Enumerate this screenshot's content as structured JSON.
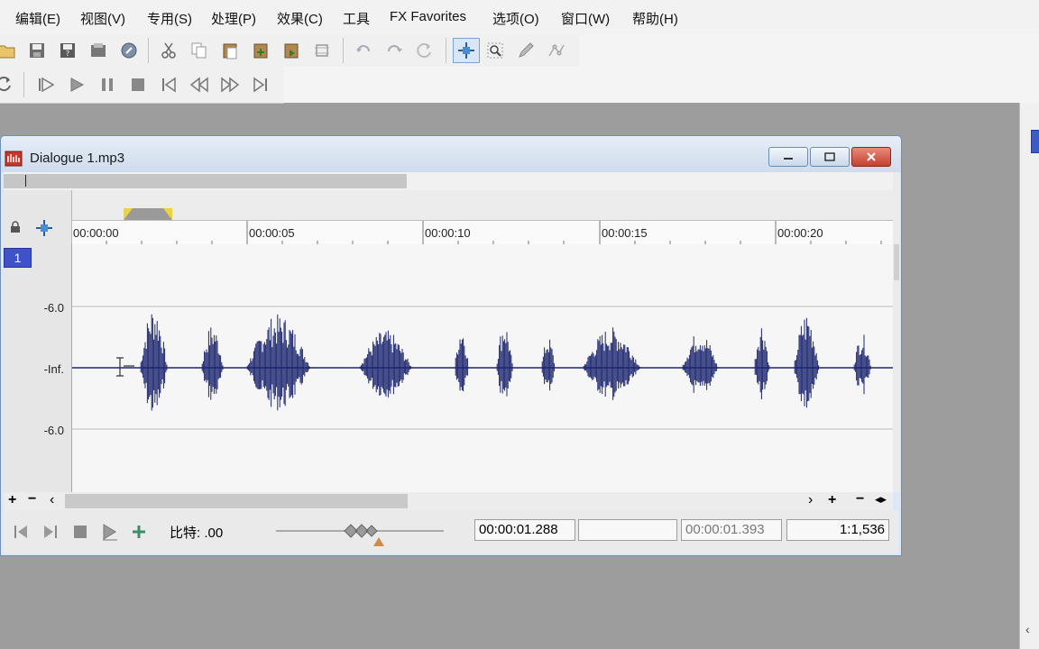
{
  "menu": [
    "编辑(E)",
    "视图(V)",
    "专用(S)",
    "处理(P)",
    "效果(C)",
    "工具",
    "FX Favorites",
    "选项(O)",
    "窗口(W)",
    "帮助(H)"
  ],
  "toolbar1": [
    {
      "name": "open-icon"
    },
    {
      "name": "save-icon"
    },
    {
      "name": "save-as-icon"
    },
    {
      "name": "render-icon"
    },
    {
      "name": "properties-icon"
    },
    {
      "name": "cut-icon"
    },
    {
      "name": "copy-icon"
    },
    {
      "name": "paste-icon"
    },
    {
      "name": "paste-new-icon"
    },
    {
      "name": "mix-icon"
    },
    {
      "name": "crop-icon"
    },
    {
      "name": "undo-icon"
    },
    {
      "name": "redo-icon"
    },
    {
      "name": "repeat-icon"
    },
    {
      "name": "edit-tool-icon"
    },
    {
      "name": "magnify-tool-icon"
    },
    {
      "name": "pencil-tool-icon"
    },
    {
      "name": "envelope-tool-icon"
    }
  ],
  "toolbar2": [
    {
      "name": "loop-icon"
    },
    {
      "name": "play-all-icon"
    },
    {
      "name": "play-icon"
    },
    {
      "name": "pause-icon"
    },
    {
      "name": "stop-icon"
    },
    {
      "name": "go-to-start-icon"
    },
    {
      "name": "rewind-icon"
    },
    {
      "name": "forward-icon"
    },
    {
      "name": "go-to-end-icon"
    }
  ],
  "window": {
    "title": "Dialogue 1.mp3",
    "track_number": "1",
    "ruler_labels": [
      "00:00:00",
      "00:00:05",
      "00:00:10",
      "00:00:15",
      "00:00:20"
    ],
    "db_labels": [
      "-6.0",
      "-Inf.",
      "-6.0"
    ],
    "wave_color": "#1c2670"
  },
  "transport": {
    "rate_label": "比特: .00",
    "cursor_time": "00:00:01.288",
    "selection_blank": "",
    "selection_length": "00:00:01.393",
    "zoom_ratio": "1:1,536"
  }
}
